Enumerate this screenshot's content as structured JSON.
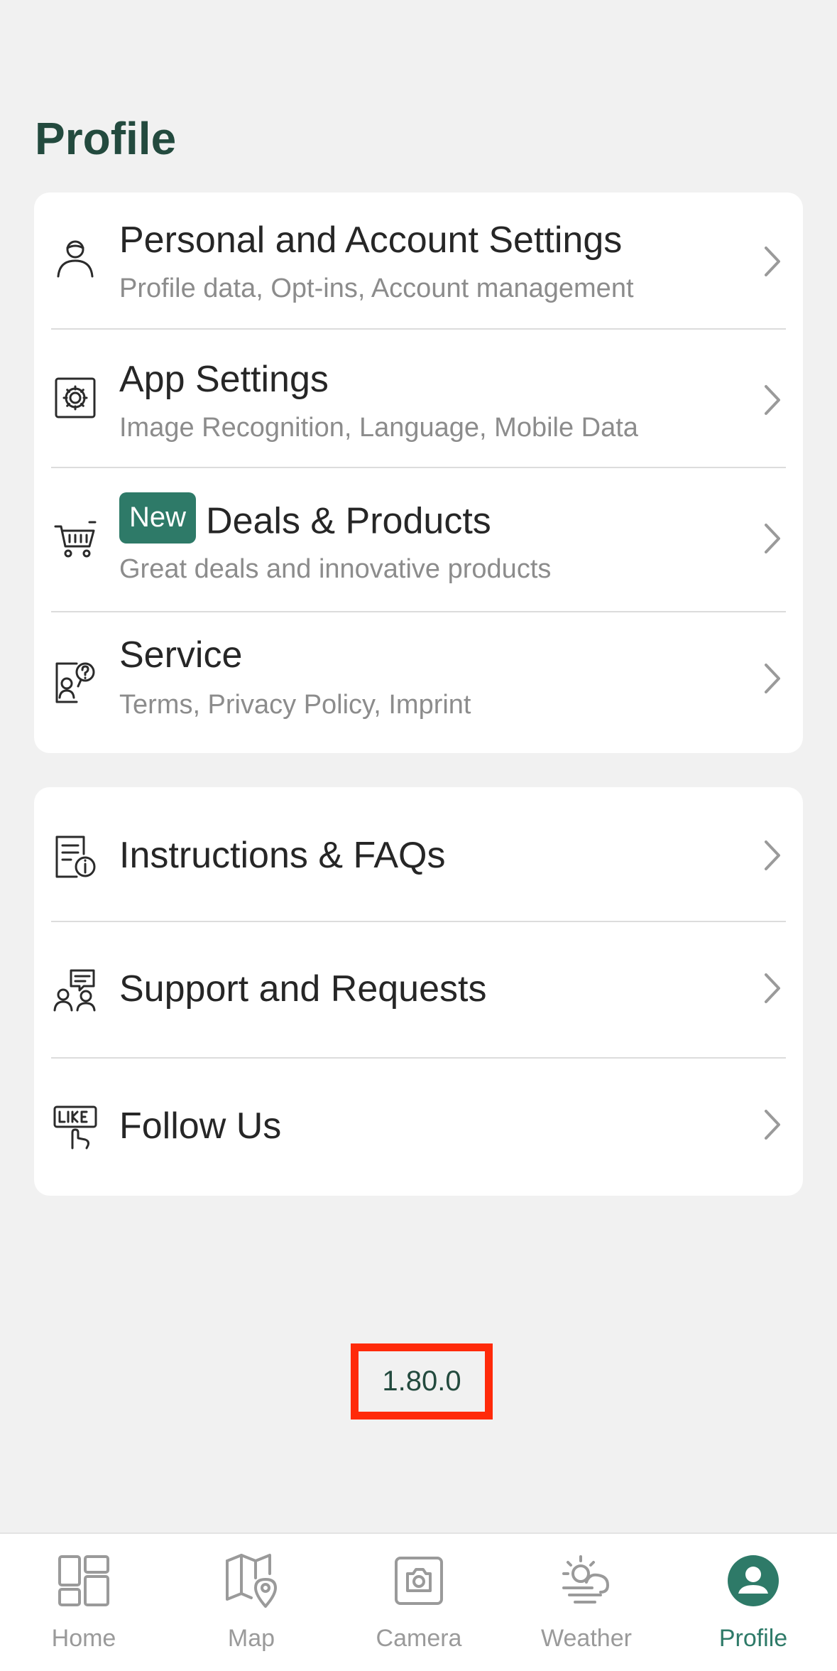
{
  "header": {
    "title": "Profile"
  },
  "settings_group": {
    "items": [
      {
        "title": "Personal and Account Settings",
        "subtitle": "Profile data, Opt-ins, Account management",
        "icon": "user-icon"
      },
      {
        "title": "App Settings",
        "subtitle": "Image Recognition, Language, Mobile Data",
        "icon": "gear-icon"
      },
      {
        "badge": "New",
        "title": "Deals & Products",
        "subtitle": "Great deals and innovative products",
        "icon": "cart-icon"
      },
      {
        "title": "Service",
        "subtitle": "Terms, Privacy Policy, Imprint",
        "icon": "service-icon"
      }
    ]
  },
  "help_group": {
    "items": [
      {
        "title": "Instructions & FAQs",
        "icon": "document-info-icon"
      },
      {
        "title": "Support and Requests",
        "icon": "support-icon"
      },
      {
        "title": "Follow Us",
        "icon": "like-icon"
      }
    ]
  },
  "version": "1.80.0",
  "tabbar": {
    "active": "Profile",
    "tabs": [
      {
        "label": "Home",
        "icon": "home-grid-icon"
      },
      {
        "label": "Map",
        "icon": "map-icon"
      },
      {
        "label": "Camera",
        "icon": "camera-icon"
      },
      {
        "label": "Weather",
        "icon": "weather-icon"
      },
      {
        "label": "Profile",
        "icon": "profile-icon"
      }
    ]
  },
  "colors": {
    "accent": "#2e7a68",
    "title": "#234a3e",
    "highlight_box": "#ff2a0a",
    "background": "#f1f1f1"
  }
}
